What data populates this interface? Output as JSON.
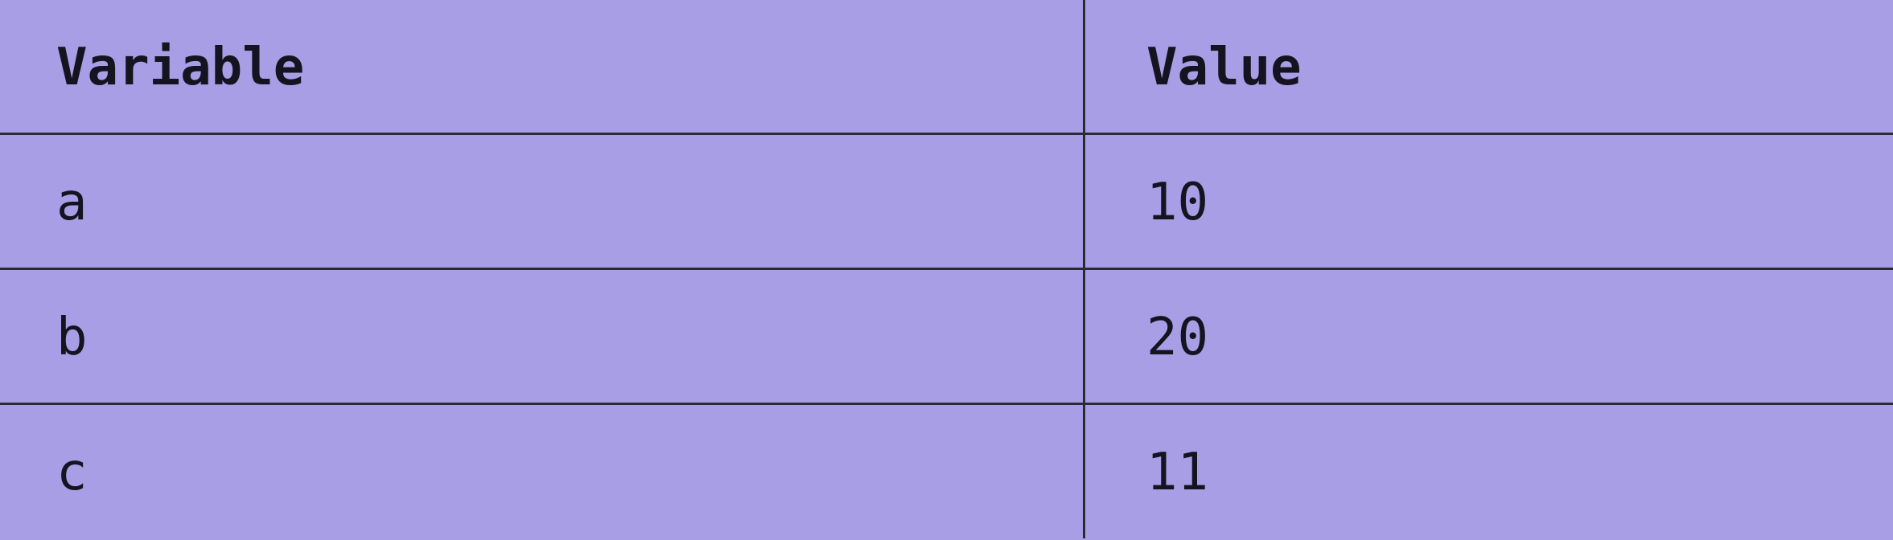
{
  "table": {
    "headers": {
      "variable": "Variable",
      "value": "Value"
    },
    "rows": [
      {
        "variable": "a",
        "value": "10"
      },
      {
        "variable": "b",
        "value": "20"
      },
      {
        "variable": "c",
        "value": "11"
      }
    ]
  },
  "colors": {
    "background": "#a89ee6",
    "text": "#15131f",
    "grid": "#2b2933"
  }
}
